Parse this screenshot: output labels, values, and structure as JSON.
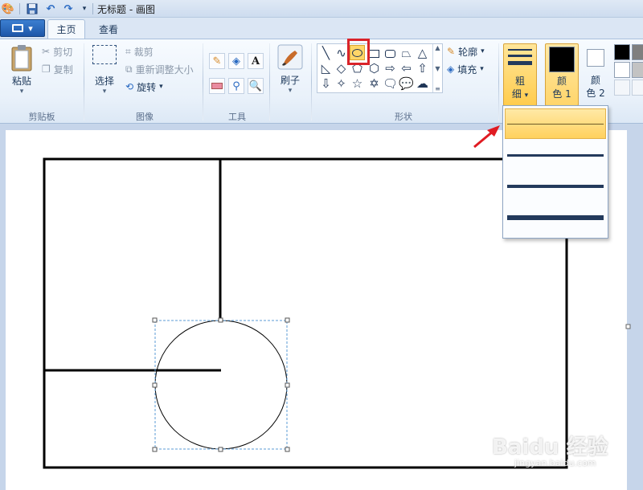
{
  "window": {
    "title": "无标题 - 画图"
  },
  "tabs": [
    {
      "label": "主页"
    },
    {
      "label": "查看"
    }
  ],
  "clipboard": {
    "paste": "粘贴",
    "cut": "剪切",
    "copy": "复制",
    "group": "剪贴板"
  },
  "image": {
    "select": "选择",
    "crop": "裁剪",
    "resize": "重新调整大小",
    "rotate": "旋转",
    "group": "图像"
  },
  "tools": {
    "group": "工具",
    "brush": "刷子"
  },
  "shapes": {
    "outline": "轮廓",
    "fill": "填充",
    "group": "形状"
  },
  "size": {
    "label_top": "粗",
    "label_bottom": "细"
  },
  "color1": {
    "label_top": "颜",
    "label_bottom": "色 1",
    "value": "#000000"
  },
  "color2": {
    "label_top": "颜",
    "label_bottom": "色 2",
    "value": "#ffffff"
  },
  "watermark": {
    "text": "Baidu 经验",
    "url": "jingyan.baidu.com"
  }
}
